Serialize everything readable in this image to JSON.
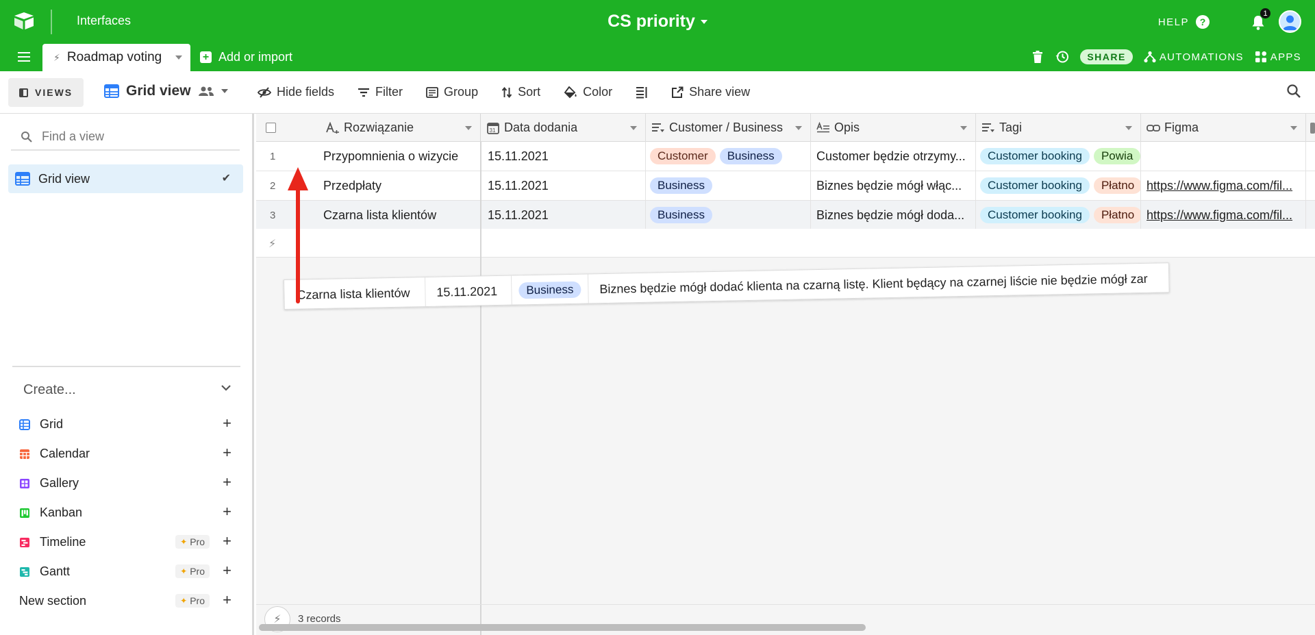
{
  "app": {
    "interfaces_label": "Interfaces",
    "base_name": "CS priority",
    "help_label": "HELP",
    "notification_count": "1",
    "colors": {
      "brand": "#1eb125",
      "selected_row": "#e3f1fb",
      "arrow": "#e8261b"
    }
  },
  "tabs": {
    "active": "Roadmap voting",
    "add_or_import": "Add or import"
  },
  "top_right": {
    "share": "SHARE",
    "automations": "AUTOMATIONS",
    "apps": "APPS"
  },
  "viewbar": {
    "views": "VIEWS",
    "current_view": "Grid view",
    "hide_fields": "Hide fields",
    "filter": "Filter",
    "group": "Group",
    "sort": "Sort",
    "color": "Color",
    "share_view": "Share view"
  },
  "sidebar": {
    "find_placeholder": "Find a view",
    "views": [
      {
        "label": "Grid view",
        "selected": true,
        "icon": "grid-icon"
      }
    ],
    "create_label": "Create...",
    "create_items": [
      {
        "label": "Grid",
        "icon": "grid-icon",
        "color": "#2d7ff9",
        "pro": ""
      },
      {
        "label": "Calendar",
        "icon": "calendar-icon",
        "color": "#f7653b",
        "pro": ""
      },
      {
        "label": "Gallery",
        "icon": "gallery-icon",
        "color": "#8b46ff",
        "pro": ""
      },
      {
        "label": "Kanban",
        "icon": "kanban-icon",
        "color": "#20c933",
        "pro": ""
      },
      {
        "label": "Timeline",
        "icon": "timeline-icon",
        "color": "#f82b60",
        "pro": "Pro"
      },
      {
        "label": "Gantt",
        "icon": "gantt-icon",
        "color": "#20d9d2",
        "pro": "Pro"
      },
      {
        "label": "New section",
        "icon": "",
        "color": "",
        "pro": "Pro"
      }
    ]
  },
  "grid": {
    "columns": [
      {
        "name": "Rozwiązanie",
        "icon": "long-text-primary-icon"
      },
      {
        "name": "Data dodania",
        "icon": "date-icon"
      },
      {
        "name": "Customer / Business",
        "icon": "multi-select-icon"
      },
      {
        "name": "Opis",
        "icon": "long-text-icon"
      },
      {
        "name": "Tagi",
        "icon": "multi-select-icon"
      },
      {
        "name": "Figma",
        "icon": "link-icon"
      }
    ],
    "rows": [
      {
        "num": "1",
        "rozwiazanie": "Przypomnienia o wizycie",
        "data": "15.11.2021",
        "customer_business": [
          "Customer",
          "Business"
        ],
        "opis": "Customer będzie otrzymy...",
        "tagi": [
          "Customer booking",
          "Powia"
        ],
        "figma": ""
      },
      {
        "num": "2",
        "rozwiazanie": "Przedpłaty",
        "data": "15.11.2021",
        "customer_business": [
          "Business"
        ],
        "opis": "Biznes będzie mógł włąc...",
        "tagi": [
          "Customer booking",
          "Płatno"
        ],
        "figma": "https://www.figma.com/fil..."
      },
      {
        "num": "3",
        "rozwiazanie": "Czarna lista klientów",
        "data": "15.11.2021",
        "customer_business": [
          "Business"
        ],
        "opis": "Biznes będzie mógł doda...",
        "tagi": [
          "Customer booking",
          "Płatno"
        ],
        "figma": "https://www.figma.com/fil..."
      }
    ],
    "drag_ghost": {
      "rozwiazanie": "Czarna lista klientów",
      "data": "15.11.2021",
      "tag": "Business",
      "opis": "Biznes będzie mógł dodać klienta na czarną listę. Klient będący na czarnej liście nie będzie mógł zar"
    },
    "records_label": "3 records"
  }
}
